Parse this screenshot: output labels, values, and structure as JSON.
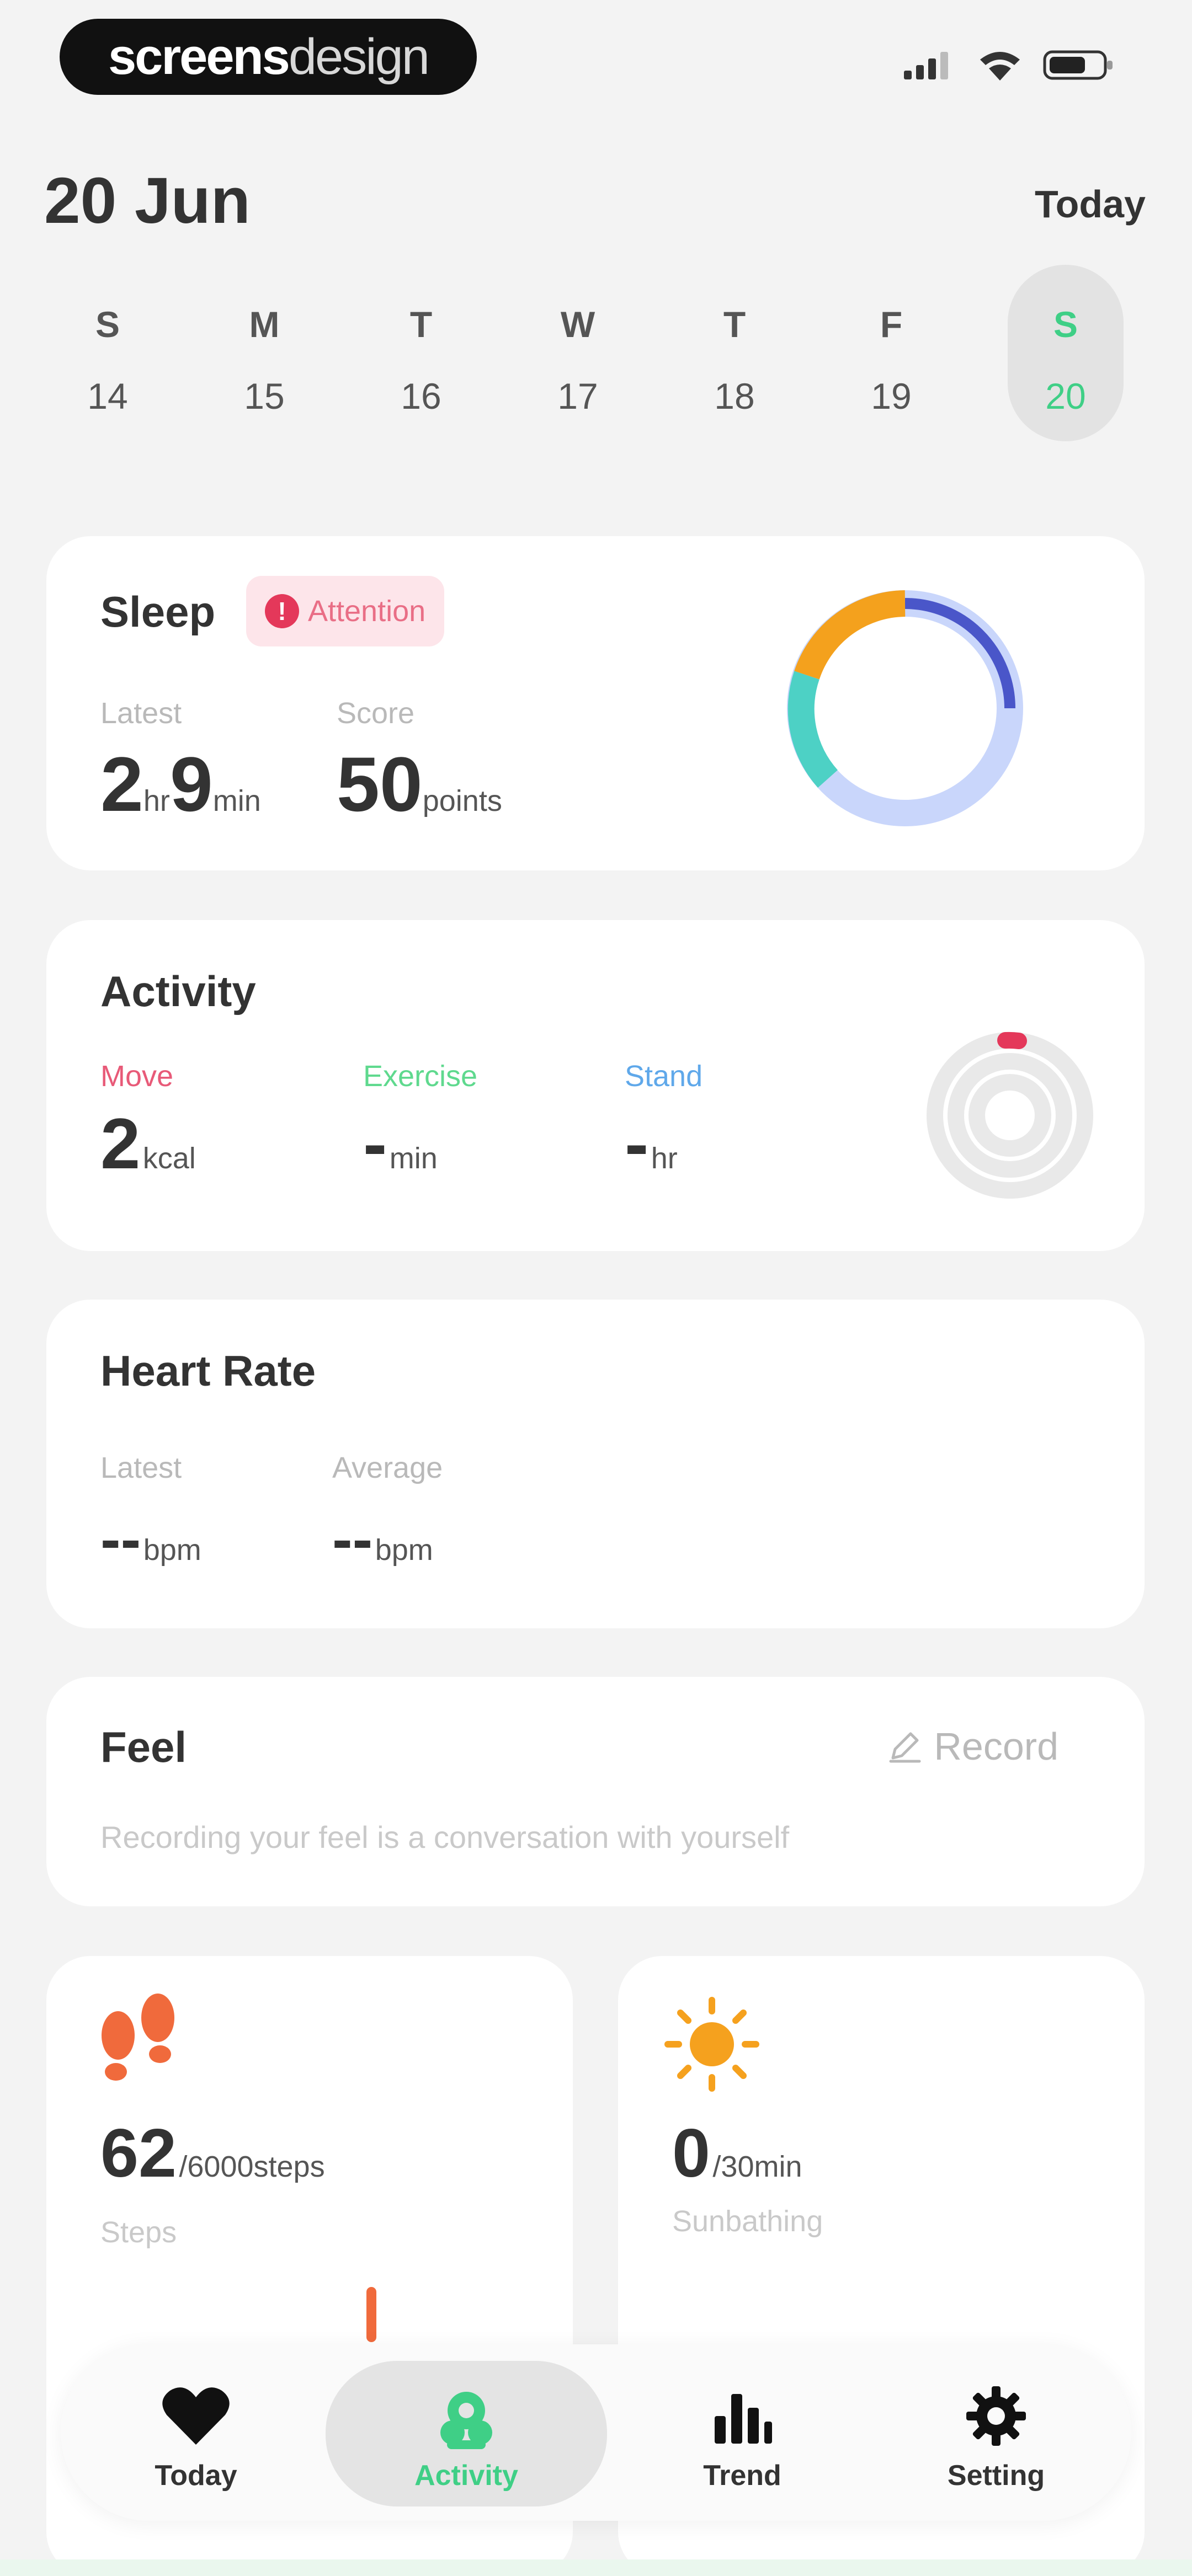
{
  "status_bar": {
    "brand_bold": "screens",
    "brand_light": "design",
    "icons": [
      "signal-icon",
      "wifi-icon",
      "battery-icon"
    ]
  },
  "header": {
    "date": "20 Jun",
    "today_label": "Today"
  },
  "week": [
    {
      "day": "S",
      "date": "14"
    },
    {
      "day": "M",
      "date": "15"
    },
    {
      "day": "T",
      "date": "16"
    },
    {
      "day": "W",
      "date": "17"
    },
    {
      "day": "T",
      "date": "18"
    },
    {
      "day": "F",
      "date": "19"
    },
    {
      "day": "S",
      "date": "20",
      "selected": true
    }
  ],
  "sleep": {
    "title": "Sleep",
    "badge": "Attention",
    "latest_label": "Latest",
    "latest_hours": "2",
    "latest_hours_unit": "hr",
    "latest_minutes": "9",
    "latest_minutes_unit": "min",
    "score_label": "Score",
    "score": "50",
    "score_unit": "points",
    "ring_colors": [
      "#f4a11d",
      "#4a56c9",
      "#c9d6fb",
      "#4dd1c5"
    ]
  },
  "activity": {
    "title": "Activity",
    "move_label": "Move",
    "move_value": "2",
    "move_unit": "kcal",
    "exercise_label": "Exercise",
    "exercise_value": "-",
    "exercise_unit": "min",
    "stand_label": "Stand",
    "stand_value": "-",
    "stand_unit": "hr",
    "colors": {
      "move": "#e85a78",
      "exercise": "#5fd98e",
      "stand": "#5fa8ea"
    }
  },
  "heart_rate": {
    "title": "Heart Rate",
    "latest_label": "Latest",
    "latest_value": "--",
    "latest_unit": "bpm",
    "average_label": "Average",
    "average_value": "--",
    "average_unit": "bpm"
  },
  "feel": {
    "title": "Feel",
    "record_label": "Record",
    "subtitle": "Recording your feel is a conversation with yourself"
  },
  "steps": {
    "value": "62",
    "goal": "/6000steps",
    "label": "Steps",
    "icon": "footprints-icon"
  },
  "sunbathing": {
    "value": "0",
    "goal": "/30min",
    "label": "Sunbathing",
    "icon": "sun-icon"
  },
  "nav": [
    {
      "label": "Today",
      "icon": "heart-icon"
    },
    {
      "label": "Activity",
      "icon": "activity-icon",
      "active": true
    },
    {
      "label": "Trend",
      "icon": "bar-chart-icon"
    },
    {
      "label": "Setting",
      "icon": "gear-icon"
    }
  ]
}
